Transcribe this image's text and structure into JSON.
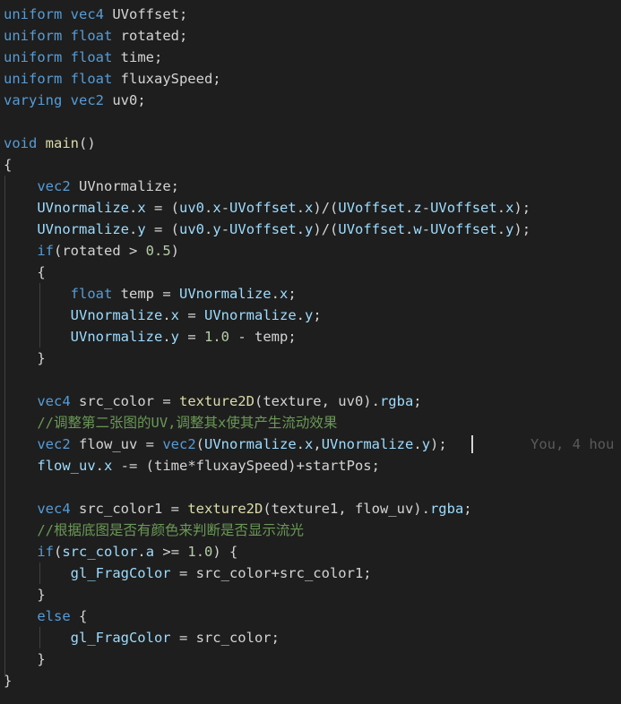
{
  "code_lines": [
    [
      {
        "t": "uniform ",
        "c": "k"
      },
      {
        "t": "vec4 ",
        "c": "k"
      },
      {
        "t": "UVoffset;",
        "c": "p"
      }
    ],
    [
      {
        "t": "uniform ",
        "c": "k"
      },
      {
        "t": "float ",
        "c": "k"
      },
      {
        "t": "rotated;",
        "c": "p"
      }
    ],
    [
      {
        "t": "uniform ",
        "c": "k"
      },
      {
        "t": "float ",
        "c": "k"
      },
      {
        "t": "time;",
        "c": "p"
      }
    ],
    [
      {
        "t": "uniform ",
        "c": "k"
      },
      {
        "t": "float ",
        "c": "k"
      },
      {
        "t": "fluxaySpeed;",
        "c": "p"
      }
    ],
    [
      {
        "t": "varying ",
        "c": "k"
      },
      {
        "t": "vec2 ",
        "c": "k"
      },
      {
        "t": "uv0;",
        "c": "p"
      }
    ],
    [],
    [
      {
        "t": "void ",
        "c": "k"
      },
      {
        "t": "main",
        "c": "f"
      },
      {
        "t": "()",
        "c": "p"
      }
    ],
    [
      {
        "t": "{",
        "c": "p"
      }
    ],
    [
      {
        "t": "    ",
        "c": "p"
      },
      {
        "t": "vec2 ",
        "c": "k"
      },
      {
        "t": "UVnormalize;",
        "c": "p"
      }
    ],
    [
      {
        "t": "    ",
        "c": "p"
      },
      {
        "t": "UVnormalize",
        "c": "v"
      },
      {
        "t": ".",
        "c": "p"
      },
      {
        "t": "x",
        "c": "v"
      },
      {
        "t": " = (",
        "c": "p"
      },
      {
        "t": "uv0",
        "c": "v"
      },
      {
        "t": ".",
        "c": "p"
      },
      {
        "t": "x",
        "c": "v"
      },
      {
        "t": "-",
        "c": "p"
      },
      {
        "t": "UVoffset",
        "c": "v"
      },
      {
        "t": ".",
        "c": "p"
      },
      {
        "t": "x",
        "c": "v"
      },
      {
        "t": ")/(",
        "c": "p"
      },
      {
        "t": "UVoffset",
        "c": "v"
      },
      {
        "t": ".",
        "c": "p"
      },
      {
        "t": "z",
        "c": "v"
      },
      {
        "t": "-",
        "c": "p"
      },
      {
        "t": "UVoffset",
        "c": "v"
      },
      {
        "t": ".",
        "c": "p"
      },
      {
        "t": "x",
        "c": "v"
      },
      {
        "t": ");",
        "c": "p"
      }
    ],
    [
      {
        "t": "    ",
        "c": "p"
      },
      {
        "t": "UVnormalize",
        "c": "v"
      },
      {
        "t": ".",
        "c": "p"
      },
      {
        "t": "y",
        "c": "v"
      },
      {
        "t": " = (",
        "c": "p"
      },
      {
        "t": "uv0",
        "c": "v"
      },
      {
        "t": ".",
        "c": "p"
      },
      {
        "t": "y",
        "c": "v"
      },
      {
        "t": "-",
        "c": "p"
      },
      {
        "t": "UVoffset",
        "c": "v"
      },
      {
        "t": ".",
        "c": "p"
      },
      {
        "t": "y",
        "c": "v"
      },
      {
        "t": ")/(",
        "c": "p"
      },
      {
        "t": "UVoffset",
        "c": "v"
      },
      {
        "t": ".",
        "c": "p"
      },
      {
        "t": "w",
        "c": "v"
      },
      {
        "t": "-",
        "c": "p"
      },
      {
        "t": "UVoffset",
        "c": "v"
      },
      {
        "t": ".",
        "c": "p"
      },
      {
        "t": "y",
        "c": "v"
      },
      {
        "t": ");",
        "c": "p"
      }
    ],
    [
      {
        "t": "    ",
        "c": "p"
      },
      {
        "t": "if",
        "c": "k"
      },
      {
        "t": "(rotated > ",
        "c": "p"
      },
      {
        "t": "0.5",
        "c": "n"
      },
      {
        "t": ")",
        "c": "p"
      }
    ],
    [
      {
        "t": "    {",
        "c": "p"
      }
    ],
    [
      {
        "t": "        ",
        "c": "p"
      },
      {
        "t": "float ",
        "c": "k"
      },
      {
        "t": "temp = ",
        "c": "p"
      },
      {
        "t": "UVnormalize",
        "c": "v"
      },
      {
        "t": ".",
        "c": "p"
      },
      {
        "t": "x",
        "c": "v"
      },
      {
        "t": ";",
        "c": "p"
      }
    ],
    [
      {
        "t": "        ",
        "c": "p"
      },
      {
        "t": "UVnormalize",
        "c": "v"
      },
      {
        "t": ".",
        "c": "p"
      },
      {
        "t": "x",
        "c": "v"
      },
      {
        "t": " = ",
        "c": "p"
      },
      {
        "t": "UVnormalize",
        "c": "v"
      },
      {
        "t": ".",
        "c": "p"
      },
      {
        "t": "y",
        "c": "v"
      },
      {
        "t": ";",
        "c": "p"
      }
    ],
    [
      {
        "t": "        ",
        "c": "p"
      },
      {
        "t": "UVnormalize",
        "c": "v"
      },
      {
        "t": ".",
        "c": "p"
      },
      {
        "t": "y",
        "c": "v"
      },
      {
        "t": " = ",
        "c": "p"
      },
      {
        "t": "1.0",
        "c": "n"
      },
      {
        "t": " - temp;",
        "c": "p"
      }
    ],
    [
      {
        "t": "    }",
        "c": "p"
      }
    ],
    [],
    [
      {
        "t": "    ",
        "c": "p"
      },
      {
        "t": "vec4 ",
        "c": "k"
      },
      {
        "t": "src_color = ",
        "c": "p"
      },
      {
        "t": "texture2D",
        "c": "f"
      },
      {
        "t": "(texture, uv0).",
        "c": "p"
      },
      {
        "t": "rgba",
        "c": "v"
      },
      {
        "t": ";",
        "c": "p"
      }
    ],
    [
      {
        "t": "    ",
        "c": "p"
      },
      {
        "t": "//调整第二张图的UV,调整其x使其产生流动效果",
        "c": "c"
      }
    ],
    [
      {
        "t": "    ",
        "c": "p"
      },
      {
        "t": "vec2 ",
        "c": "k"
      },
      {
        "t": "flow_uv = ",
        "c": "p"
      },
      {
        "t": "vec2",
        "c": "k"
      },
      {
        "t": "(",
        "c": "p"
      },
      {
        "t": "UVnormalize",
        "c": "v"
      },
      {
        "t": ".",
        "c": "p"
      },
      {
        "t": "x",
        "c": "v"
      },
      {
        "t": ",",
        "c": "p"
      },
      {
        "t": "UVnormalize",
        "c": "v"
      },
      {
        "t": ".",
        "c": "p"
      },
      {
        "t": "y",
        "c": "v"
      },
      {
        "t": ");",
        "c": "p"
      }
    ],
    [
      {
        "t": "    ",
        "c": "p"
      },
      {
        "t": "flow_uv",
        "c": "v"
      },
      {
        "t": ".",
        "c": "p"
      },
      {
        "t": "x",
        "c": "v"
      },
      {
        "t": " -= (time*fluxaySpeed)+startPos;",
        "c": "p"
      }
    ],
    [],
    [
      {
        "t": "    ",
        "c": "p"
      },
      {
        "t": "vec4 ",
        "c": "k"
      },
      {
        "t": "src_color1 = ",
        "c": "p"
      },
      {
        "t": "texture2D",
        "c": "f"
      },
      {
        "t": "(texture1, flow_uv).",
        "c": "p"
      },
      {
        "t": "rgba",
        "c": "v"
      },
      {
        "t": ";",
        "c": "p"
      }
    ],
    [
      {
        "t": "    ",
        "c": "p"
      },
      {
        "t": "//根据底图是否有颜色来判断是否显示流光",
        "c": "c"
      }
    ],
    [
      {
        "t": "    ",
        "c": "p"
      },
      {
        "t": "if",
        "c": "k"
      },
      {
        "t": "(",
        "c": "p"
      },
      {
        "t": "src_color",
        "c": "v"
      },
      {
        "t": ".",
        "c": "p"
      },
      {
        "t": "a",
        "c": "v"
      },
      {
        "t": " >= ",
        "c": "p"
      },
      {
        "t": "1.0",
        "c": "n"
      },
      {
        "t": ") {",
        "c": "p"
      }
    ],
    [
      {
        "t": "        ",
        "c": "p"
      },
      {
        "t": "gl_FragColor",
        "c": "v"
      },
      {
        "t": " = src_color+src_color1;",
        "c": "p"
      }
    ],
    [
      {
        "t": "    }",
        "c": "p"
      }
    ],
    [
      {
        "t": "    ",
        "c": "p"
      },
      {
        "t": "else",
        "c": "k"
      },
      {
        "t": " {",
        "c": "p"
      }
    ],
    [
      {
        "t": "        ",
        "c": "p"
      },
      {
        "t": "gl_FragColor",
        "c": "v"
      },
      {
        "t": " = src_color;",
        "c": "p"
      }
    ],
    [
      {
        "t": "    }",
        "c": "p"
      }
    ],
    [
      {
        "t": "}",
        "c": "p"
      }
    ]
  ],
  "blame_annotation": "You, 4 hou",
  "colors": {
    "background": "#1e1e1e",
    "keyword": "#569cd6",
    "function": "#dcdcaa",
    "variable": "#9cdcfe",
    "number": "#b5cea8",
    "comment": "#6a9955",
    "text": "#d4d4d4"
  }
}
